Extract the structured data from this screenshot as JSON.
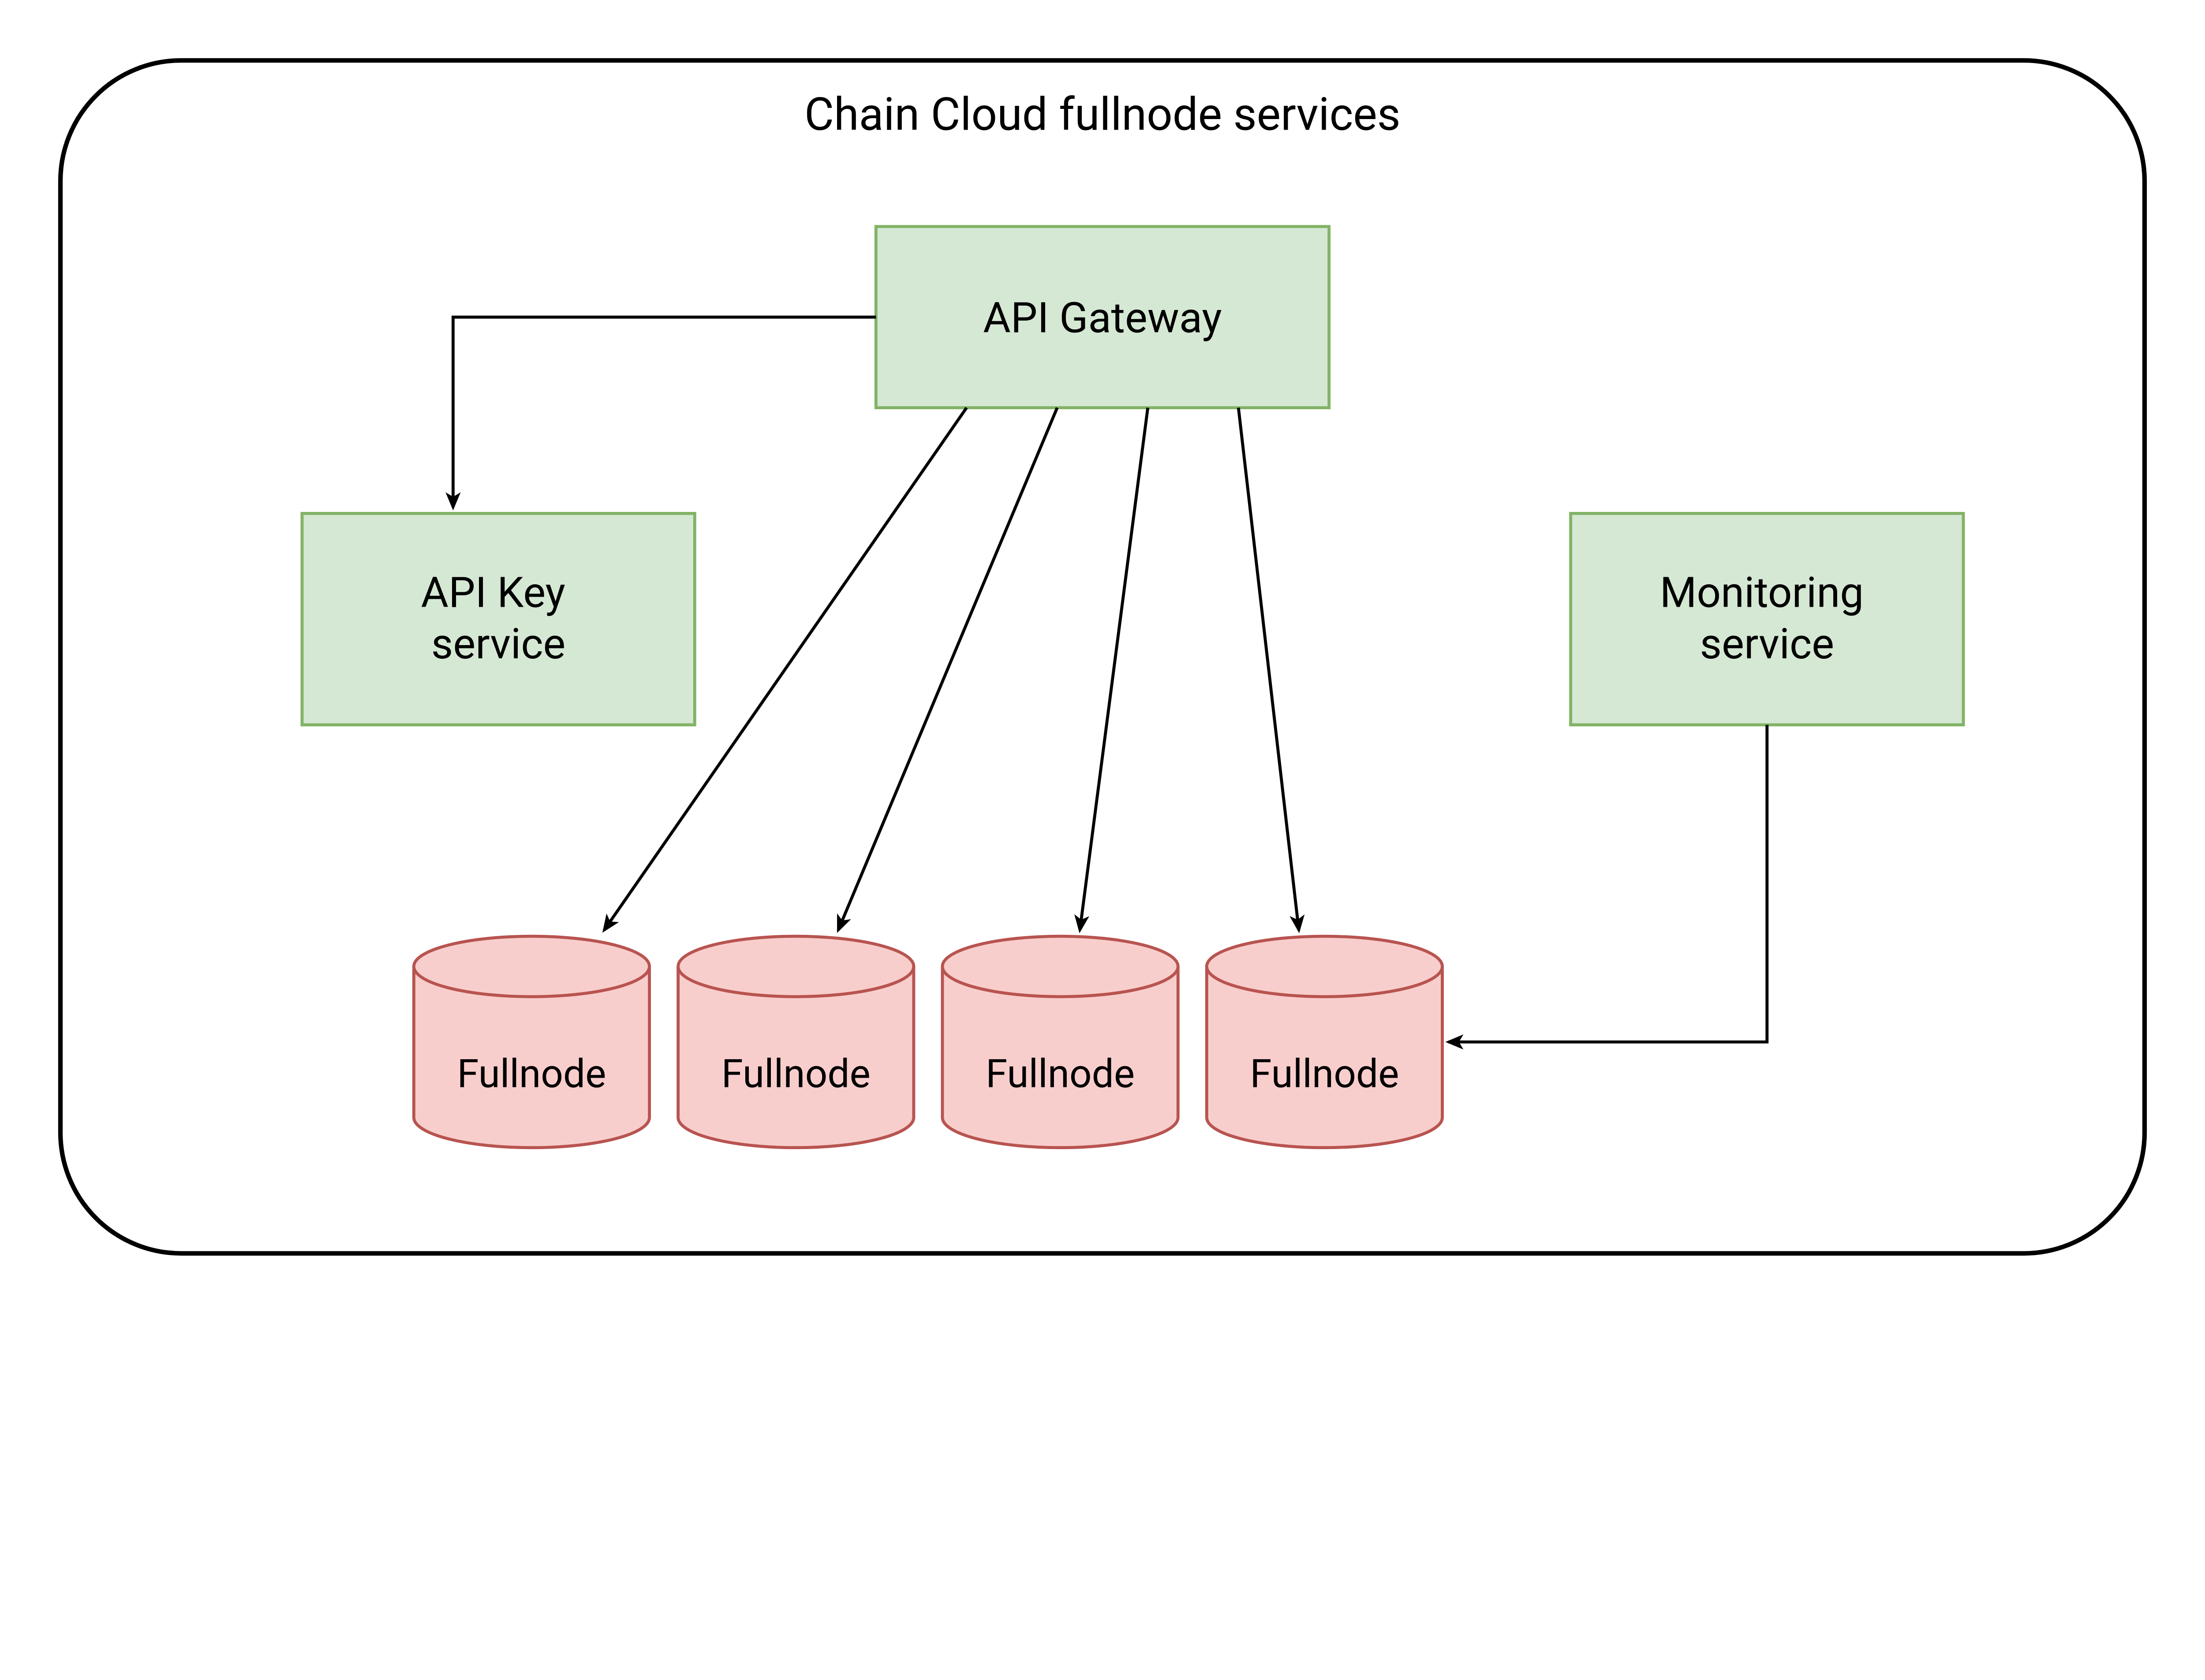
{
  "diagram": {
    "title": "Chain Cloud fullnode services",
    "nodes": {
      "api_gateway": {
        "label": "API Gateway",
        "type": "box",
        "fill": "#d5e8d4",
        "stroke": "#82b366"
      },
      "api_key_service": {
        "label": "API Key\nservice",
        "type": "box",
        "fill": "#d5e8d4",
        "stroke": "#82b366"
      },
      "monitoring_service": {
        "label": "Monitoring\nservice",
        "type": "box",
        "fill": "#d5e8d4",
        "stroke": "#82b366"
      },
      "fullnodes": [
        {
          "label": "Fullnode",
          "type": "cylinder",
          "fill": "#f8cecc",
          "stroke": "#b85450"
        },
        {
          "label": "Fullnode",
          "type": "cylinder",
          "fill": "#f8cecc",
          "stroke": "#b85450"
        },
        {
          "label": "Fullnode",
          "type": "cylinder",
          "fill": "#f8cecc",
          "stroke": "#b85450"
        },
        {
          "label": "Fullnode",
          "type": "cylinder",
          "fill": "#f8cecc",
          "stroke": "#b85450"
        }
      ]
    },
    "edges": [
      {
        "from": "api_gateway",
        "to": "api_key_service"
      },
      {
        "from": "api_gateway",
        "to": "fullnodes[0]"
      },
      {
        "from": "api_gateway",
        "to": "fullnodes[1]"
      },
      {
        "from": "api_gateway",
        "to": "fullnodes[2]"
      },
      {
        "from": "api_gateway",
        "to": "fullnodes[3]"
      },
      {
        "from": "monitoring_service",
        "to": "fullnodes[3]"
      }
    ],
    "container": {
      "stroke": "#000000",
      "fill": "none"
    }
  }
}
